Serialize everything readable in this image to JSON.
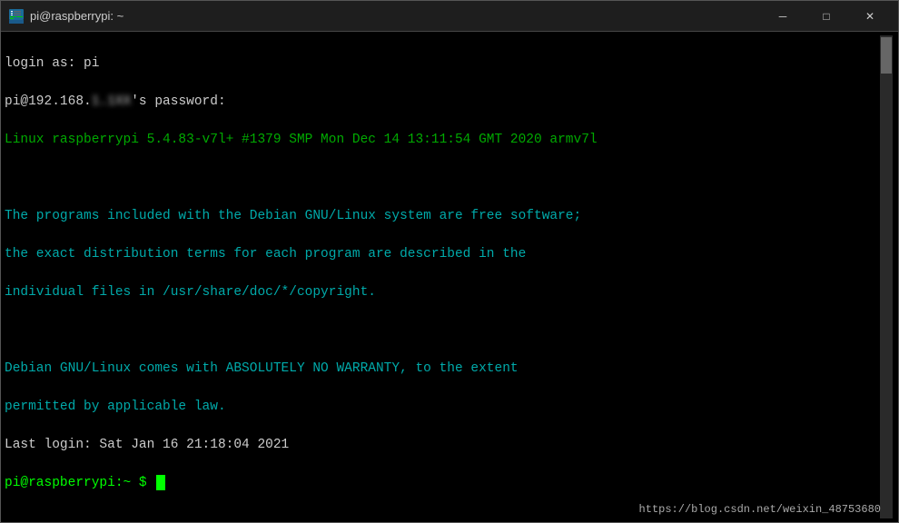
{
  "titlebar": {
    "title": "pi@raspberrypi: ~",
    "minimize_label": "─",
    "maximize_label": "□",
    "close_label": "✕"
  },
  "terminal": {
    "line1": "login as: pi",
    "line2_prefix": "pi@192.168.",
    "line2_blurred": "1.1XX",
    "line2_suffix": "'s password:",
    "line3": "Linux raspberrypi 5.4.83-v7l+ #1379 SMP Mon Dec 14 13:11:54 GMT 2020 armv7l",
    "line4": "",
    "line5": "The programs included with the Debian GNU/Linux system are free software;",
    "line6": "the exact distribution terms for each program are described in the",
    "line7": "individual files in /usr/share/doc/*/copyright.",
    "line8": "",
    "line9": "Debian GNU/Linux comes with ABSOLUTELY NO WARRANTY, to the extent",
    "line10": "permitted by applicable law.",
    "line11": "Last login: Sat Jan 16 21:18:04 2021",
    "prompt": "pi@raspberrypi:~ $ ",
    "watermark": "https://blog.csdn.net/weixin_48753680"
  }
}
